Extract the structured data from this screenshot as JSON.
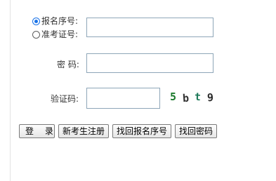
{
  "login_type": {
    "options": [
      {
        "label": "报名序号:",
        "selected": true
      },
      {
        "label": "准考证号:",
        "selected": false
      }
    ],
    "value": ""
  },
  "password": {
    "label": "密 码:",
    "value": ""
  },
  "verification": {
    "label": "验证码:",
    "value": "",
    "captcha_chars": [
      "5",
      "b",
      "t",
      "9"
    ]
  },
  "buttons": {
    "login": "登 录",
    "register": "新考生注册",
    "recover_id": "找回报名序号",
    "recover_password": "找回密码"
  },
  "colors": {
    "input_border": "#8ea6b8",
    "radio_selected": "#1a73e8",
    "captcha_primary": "#1b7a2c"
  }
}
